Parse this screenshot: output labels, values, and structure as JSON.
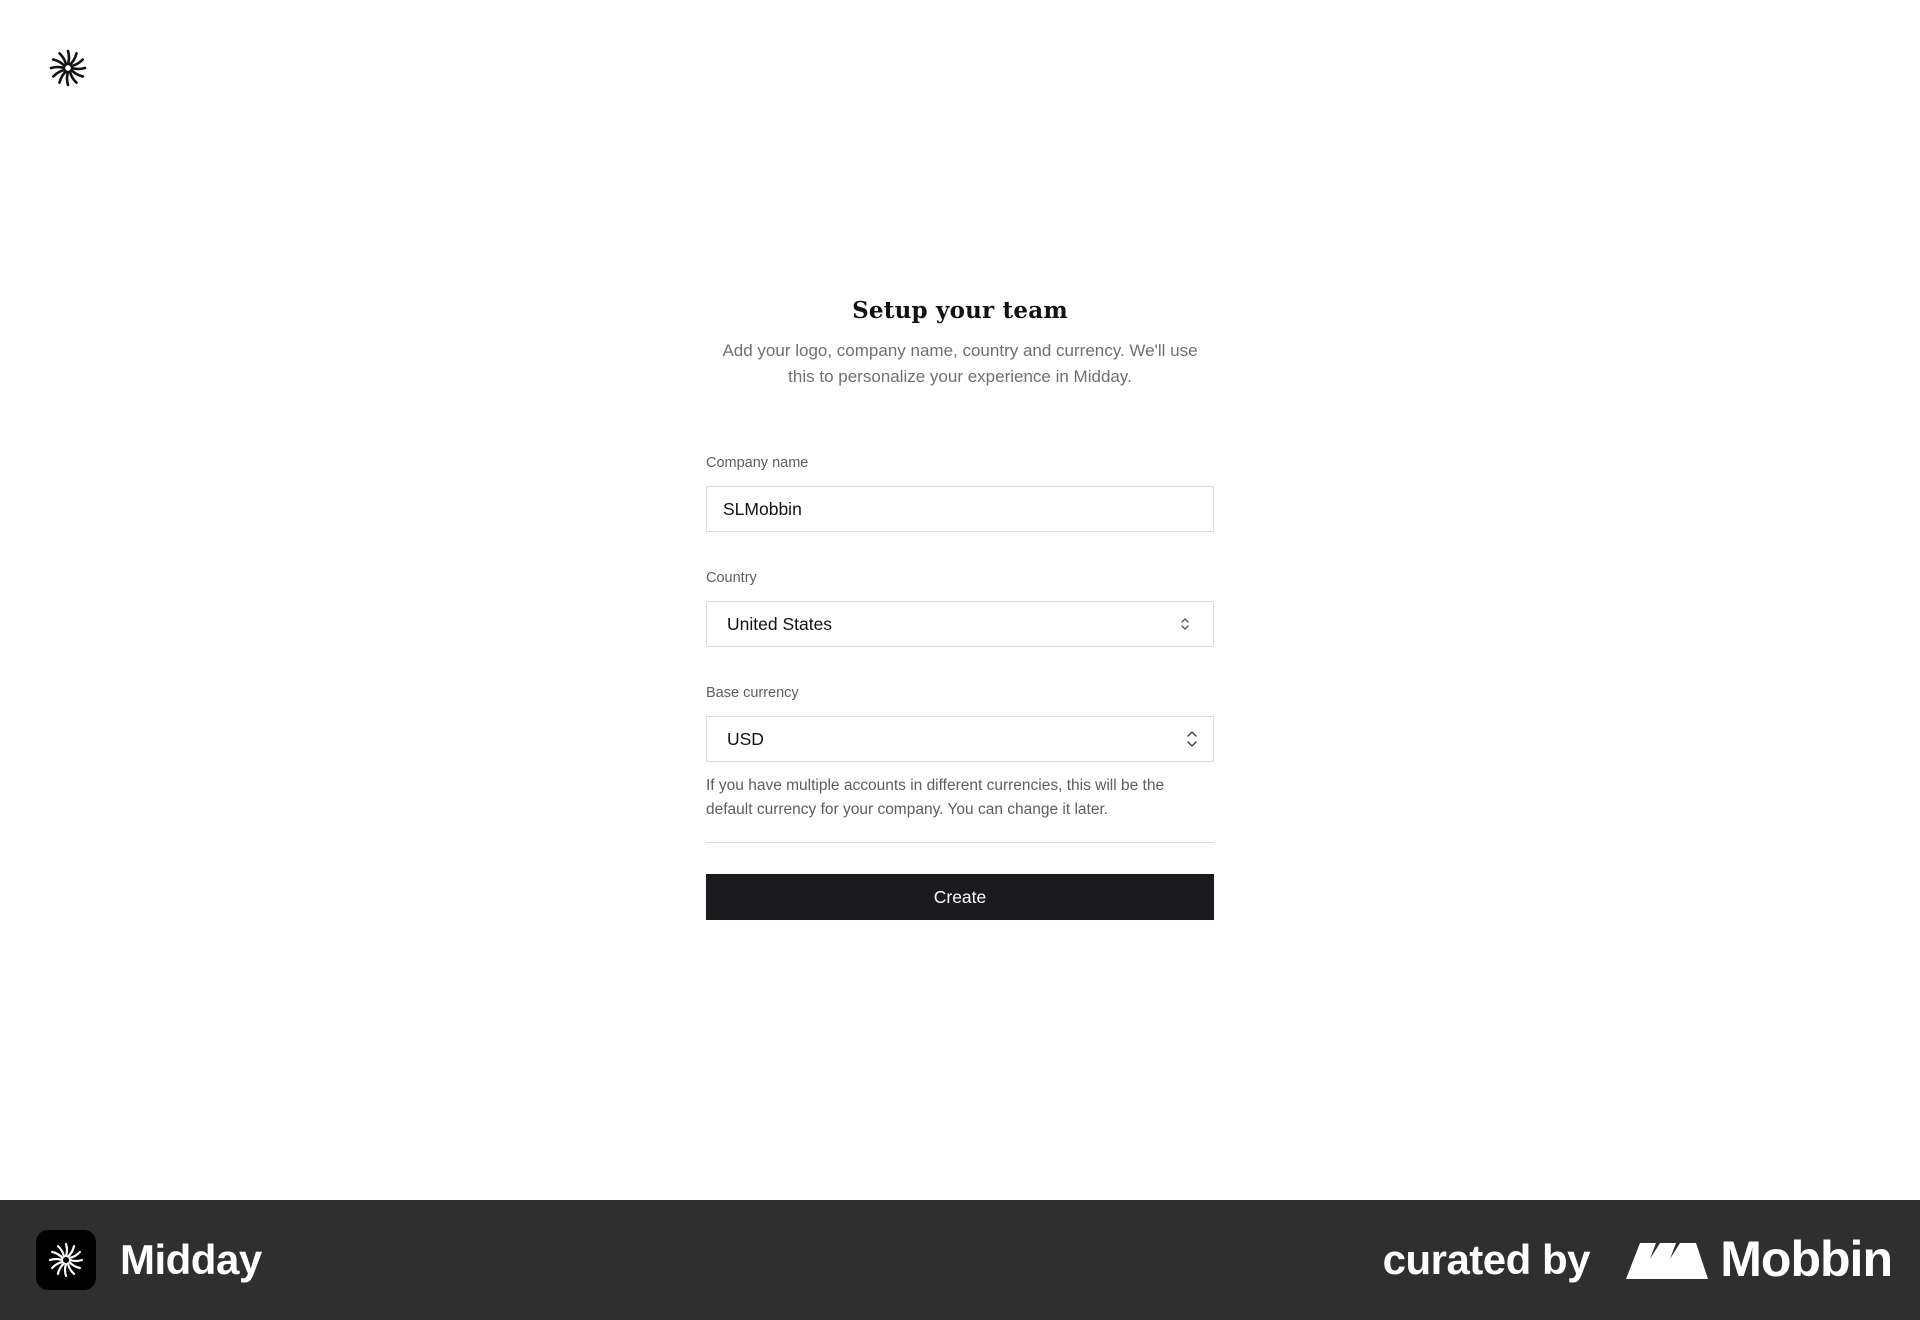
{
  "app": {
    "logo_icon": "midday-sunburst-icon"
  },
  "form": {
    "title": "Setup your team",
    "subtitle": "Add your logo, company name, country and currency. We'll use this to personalize your experience in Midday.",
    "company_name": {
      "label": "Company name",
      "value": "SLMobbin"
    },
    "country": {
      "label": "Country",
      "value": "United States",
      "icon": "chevron-up-down-icon"
    },
    "base_currency": {
      "label": "Base currency",
      "value": "USD",
      "icon": "chevron-up-down-icon",
      "help_text": "If you have multiple accounts in different currencies, this will be the default currency for your company. You can change it later."
    },
    "create_label": "Create"
  },
  "footer": {
    "app_name": "Midday",
    "curated_by": "curated by",
    "brand_name": "Mobbin",
    "background": "#2f2f2f"
  },
  "colors": {
    "primary_button": "#1b1b1d",
    "muted_text": "#707070",
    "border": "#dcdcdc"
  }
}
